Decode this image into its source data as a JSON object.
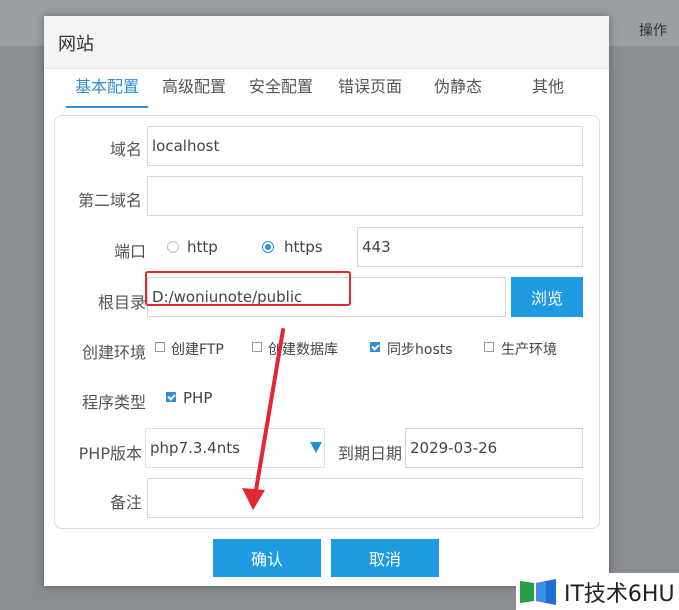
{
  "background": {
    "operation_label": "操作"
  },
  "dialog": {
    "title": "网站",
    "tabs": [
      "基本配置",
      "高级配置",
      "安全配置",
      "错误页面",
      "伪静态",
      "其他"
    ],
    "active_tab": "基本配置",
    "form": {
      "domain": {
        "label": "域名",
        "value": "localhost"
      },
      "second_domain": {
        "label": "第二域名",
        "value": ""
      },
      "port": {
        "label": "端口",
        "options": [
          "http",
          "https"
        ],
        "selected": "https",
        "value": "443"
      },
      "root": {
        "label": "根目录",
        "value": "D:/woniunote/public",
        "browse_label": "浏览"
      },
      "env": {
        "label": "创建环境",
        "options": [
          {
            "label": "创建FTP",
            "checked": false
          },
          {
            "label": "创建数据库",
            "checked": false
          },
          {
            "label": "同步hosts",
            "checked": true
          },
          {
            "label": "生产环境",
            "checked": false
          }
        ]
      },
      "program_type": {
        "label": "程序类型",
        "options": [
          {
            "label": "PHP",
            "checked": true
          }
        ]
      },
      "php_version": {
        "label": "PHP版本",
        "value": "php7.3.4nts"
      },
      "expire_date": {
        "label": "到期日期",
        "value": "2029-03-26"
      },
      "remark": {
        "label": "备注",
        "value": ""
      }
    },
    "buttons": {
      "confirm": "确认",
      "cancel": "取消"
    }
  },
  "watermark": {
    "text": "IT技术6HU"
  },
  "colors": {
    "accent": "#1e9be0",
    "annotation": "#e3262f"
  },
  "icons": [
    "select-arrow-icon",
    "annotation-arrow-icon",
    "watermark-logo-icon"
  ]
}
